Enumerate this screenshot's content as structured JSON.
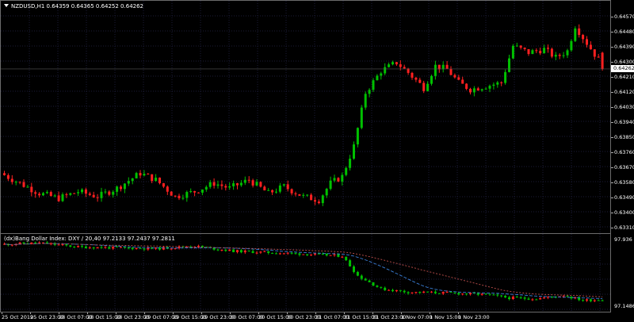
{
  "main_chart": {
    "title": "NZDUSD,H1  0.64359 0.64365 0.64252 0.64262",
    "current_price": "0.64262",
    "y_labels": [
      "0.64570",
      "0.64480",
      "0.64390",
      "0.64300",
      "0.64210",
      "0.64120",
      "0.64030",
      "0.63940",
      "0.63850",
      "0.63760",
      "0.63670",
      "0.63580",
      "0.63490",
      "0.63400",
      "0.63310"
    ]
  },
  "indicator": {
    "title": "(dx)Bang Dollar Index: DXY / 20,40 97.2133 97.2437 97.2811",
    "y_labels": [
      "97.936",
      "97.1486"
    ]
  },
  "x_labels": [
    "25 Oct 2019",
    "25 Oct 23:00",
    "28 Oct 07:00",
    "28 Oct 15:00",
    "28 Oct 23:00",
    "29 Oct 07:00",
    "29 Oct 15:00",
    "29 Oct 23:00",
    "30 Oct 07:00",
    "30 Oct 15:00",
    "30 Oct 23:00",
    "31 Oct 07:00",
    "31 Oct 15:00",
    "31 Oct 23:00",
    "1 Nov 07:00",
    "1 Nov 15:00",
    "1 Nov 23:00"
  ],
  "colors": {
    "background": "#000000",
    "bull": "#00c000",
    "bear": "#ff2020",
    "ma_fast": "#3a7fd8",
    "ma_slow": "#c0504d"
  },
  "chart_data": [
    {
      "type": "candlestick",
      "title": "NZDUSD,H1",
      "ylim": [
        0.6331,
        0.6465
      ],
      "ohlc": [],
      "generated_from_script": true
    },
    {
      "type": "candlestick",
      "title": "(dx)Bang Dollar Index: DXY / 20,40",
      "ylim": [
        97.1,
        97.95
      ],
      "series": [
        {
          "name": "DXY",
          "values": [
            97.2133
          ]
        },
        {
          "name": "MA20",
          "values": [
            97.2437
          ]
        },
        {
          "name": "MA40",
          "values": [
            97.2811
          ]
        }
      ]
    }
  ]
}
